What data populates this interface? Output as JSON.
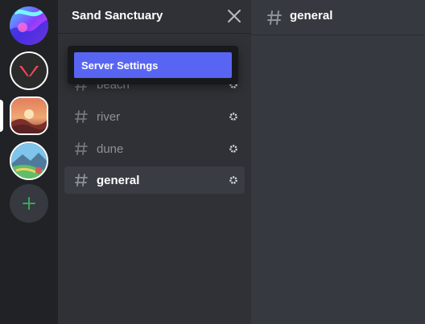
{
  "servers": [
    {
      "name": "server-1-icon",
      "icon": "abstract-swirl-icon"
    },
    {
      "name": "server-2-icon",
      "icon": "red-logo-icon"
    },
    {
      "name": "server-3-icon",
      "icon": "desert-sunset-icon",
      "selected": true
    },
    {
      "name": "server-4-icon",
      "icon": "landscape-icon"
    }
  ],
  "add_server_icon": "plus-icon",
  "sidebar": {
    "server_name": "Sand Sanctuary",
    "close_icon": "close-icon",
    "channels": [
      {
        "name": "beach",
        "active": false
      },
      {
        "name": "river",
        "active": false
      },
      {
        "name": "dune",
        "active": false
      },
      {
        "name": "general",
        "active": true
      }
    ]
  },
  "popup": {
    "item_label": "Server Settings"
  },
  "main": {
    "channel_title": "general"
  },
  "colors": {
    "rail_bg": "#202225",
    "sidebar_bg": "#2f3136",
    "main_bg": "#36393f",
    "accent": "#5865f2",
    "add_green": "#3ba55d"
  }
}
